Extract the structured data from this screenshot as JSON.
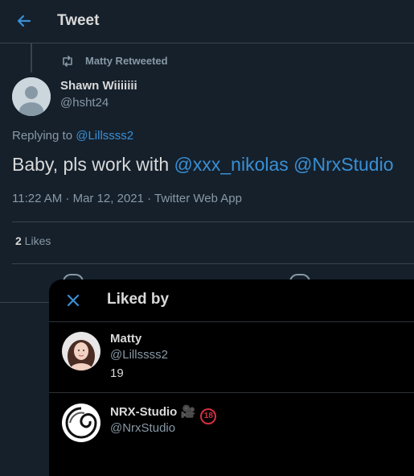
{
  "header": {
    "title": "Tweet",
    "back_icon": "arrow-left-icon"
  },
  "retweet": {
    "text": "Matty Retweeted",
    "icon": "retweet-icon"
  },
  "tweet": {
    "display_name": "Shawn Wiiiiiii",
    "handle": "@hsht24",
    "replying_prefix": "Replying to ",
    "replying_to": "@Lillssss2",
    "text_prefix": "Baby, pls work with ",
    "mention1": "@xxx_nikolas",
    "mention2": "@NrxStudio",
    "meta": "11:22 AM · Mar 12, 2021 · Twitter Web App",
    "likes_count": "2",
    "likes_label": " Likes"
  },
  "colors": {
    "background": "#15202b",
    "modal": "#000000",
    "link": "#3a8fd4",
    "secondary": "#8899a6"
  },
  "modal": {
    "title": "Liked by",
    "close_icon": "close-icon",
    "users": [
      {
        "name": "Matty",
        "handle": "@Lillssss2",
        "bio": "19"
      },
      {
        "name": "NRX-Studio 🎥",
        "badge": "18",
        "handle": "@NrxStudio"
      }
    ]
  }
}
